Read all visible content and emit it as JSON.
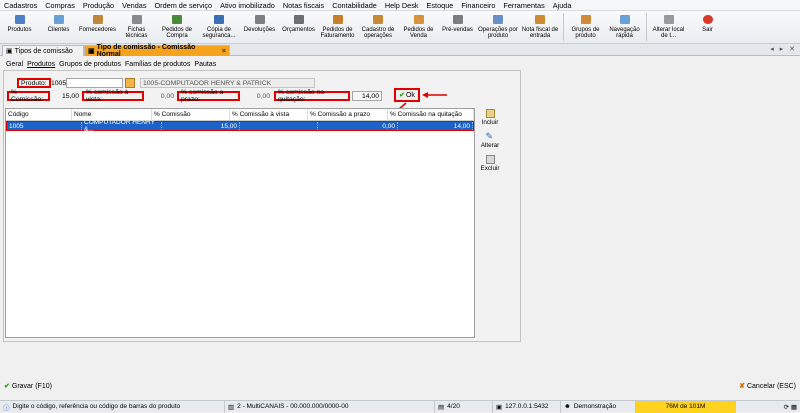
{
  "menu": [
    "Cadastros",
    "Compras",
    "Produção",
    "Vendas",
    "Ordem de serviço",
    "Ativo imobilizado",
    "Notas fiscais",
    "Contabilidade",
    "Help Desk",
    "Estoque",
    "Financeiro",
    "Ferramentas",
    "Ajuda"
  ],
  "toolbar": [
    {
      "label": "Produtos",
      "icon": "box-icon"
    },
    {
      "label": "Clientes",
      "icon": "users-icon"
    },
    {
      "label": "Fornecedores",
      "icon": "truck-icon"
    },
    {
      "label": "Fichas técnicas",
      "icon": "sheet-icon"
    },
    {
      "label": "Pedidos de Compra",
      "icon": "cart-icon"
    },
    {
      "label": "Cópia de seguranca...",
      "icon": "disk-icon"
    },
    {
      "label": "Devoluções",
      "icon": "return-icon"
    },
    {
      "label": "Orçamentos",
      "icon": "quote-icon"
    },
    {
      "label": "Pedidos de Faturamento",
      "icon": "invoice-icon"
    },
    {
      "label": "Cadastro de operações",
      "icon": "ops-icon"
    },
    {
      "label": "Pedidos de Venda",
      "icon": "sale-icon"
    },
    {
      "label": "Pré-vendas",
      "icon": "pre-sale-icon"
    },
    {
      "label": "Operações por produto",
      "icon": "ops-product-icon"
    },
    {
      "label": "Nota fiscal de entrada",
      "icon": "nf-icon"
    },
    {
      "label": "Grupos de produto",
      "icon": "group-icon"
    },
    {
      "label": "Navegação rápida",
      "icon": "nav-icon"
    },
    {
      "label": "Alterar local de t...",
      "icon": "home-icon"
    },
    {
      "label": "Sair",
      "icon": "exit-icon"
    }
  ],
  "tabs": {
    "inactive": "Tipos de comissão",
    "active": "Tipo de comissão - Comissão Normal"
  },
  "subtabs": [
    "Geral",
    "Produtos",
    "Grupos de produtos",
    "Famílias de produtos",
    "Pautas"
  ],
  "form": {
    "produto_label": "Produto:",
    "produto_value": "1005",
    "produto_name": "1005-COMPUTADOR HENRY & PATRICK",
    "comissao_label": "% Comissão:",
    "comissao_value": "15,00",
    "vista_label": "% comissão à vista:",
    "vista_value": "0,00",
    "prazo_label": "% comissão a prazo:",
    "prazo_value": "0,00",
    "quitacao_label": "% comissão na quitação:",
    "quitacao_value": "14,00",
    "ok_label": "Ok"
  },
  "grid": {
    "headers": [
      "Código",
      "Nome",
      "% Comissão",
      "% Comissão à vista",
      "% Comissão a prazo",
      "% Comissão na quitação"
    ],
    "rows": [
      [
        "1005",
        "COMPUTADOR HENRY &...",
        "15,00",
        "",
        "0,00",
        "14,00"
      ]
    ]
  },
  "side": {
    "incluir": "Incluir",
    "alterar": "Alterar",
    "excluir": "Excluir"
  },
  "bottom": {
    "gravar": "Gravar (F10)",
    "cancelar": "Cancelar (ESC)"
  },
  "status": {
    "hint": "Digite o código, referência ou código de barras do produto",
    "conn": "2 - MultiCANAIS - 00.000.000/0000-00",
    "page": "4/20",
    "ip": "127.0.0.1:5432",
    "user": "Demonstração",
    "mem": "76M de 101M"
  }
}
